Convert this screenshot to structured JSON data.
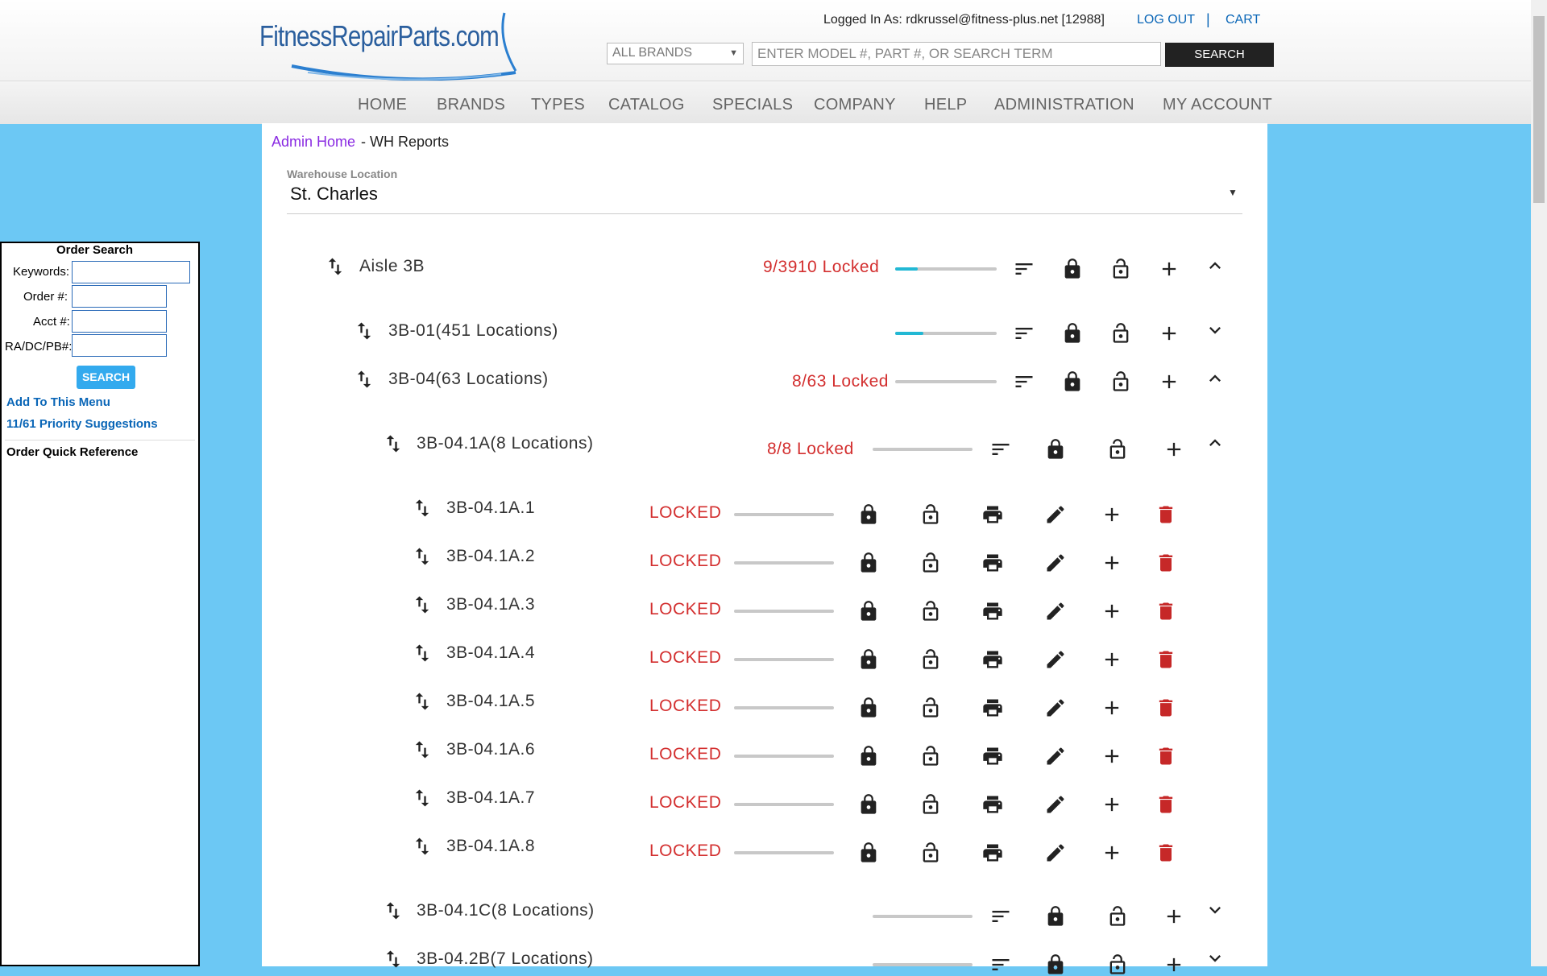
{
  "header": {
    "logo_text": "FitnessRepairParts.com",
    "logged_in": "Logged In As: rdkrussel@fitness-plus.net [12988]",
    "logout": "LOG OUT",
    "separator": "|",
    "cart": "CART",
    "brands_select": "ALL BRANDS",
    "search_placeholder": "ENTER MODEL #, PART #, OR SEARCH TERM",
    "search_button": "SEARCH"
  },
  "nav": [
    "HOME",
    "BRANDS",
    "TYPES",
    "CATALOG",
    "SPECIALS",
    "COMPANY",
    "HELP",
    "ADMINISTRATION",
    "MY ACCOUNT"
  ],
  "sidebar": {
    "title": "Order Search",
    "fields": [
      "Keywords:",
      "Order #:",
      "Acct #:",
      "RA/DC/PB#:"
    ],
    "search_button": "SEARCH",
    "links": [
      "Add To This Menu",
      "11/61 Priority Suggestions"
    ],
    "quick_reference": "Order Quick Reference"
  },
  "breadcrumb": {
    "admin_home": "Admin Home",
    "rest": " - WH Reports"
  },
  "warehouse": {
    "label": "Warehouse Location",
    "value": "St. Charles"
  },
  "tree": {
    "aisle": {
      "label": "Aisle 3B",
      "status": "9/3910 Locked",
      "progress": 0.22,
      "expanded": true
    },
    "groups": [
      {
        "label": "3B-01(451 Locations)",
        "status": "",
        "progress": 0.28,
        "expanded": false
      },
      {
        "label": "3B-04(63 Locations)",
        "status": "8/63 Locked",
        "progress": 0,
        "expanded": true
      }
    ],
    "subgroups": [
      {
        "label": "3B-04.1A(8 Locations)",
        "status": "8/8 Locked",
        "progress": 0,
        "expanded": true
      },
      {
        "label": "3B-04.1C(8 Locations)",
        "status": "",
        "progress": 0,
        "expanded": false
      },
      {
        "label": "3B-04.2B(7 Locations)",
        "status": "",
        "progress": 0,
        "expanded": false
      }
    ],
    "locations": [
      {
        "label": "3B-04.1A.1",
        "status": "LOCKED"
      },
      {
        "label": "3B-04.1A.2",
        "status": "LOCKED"
      },
      {
        "label": "3B-04.1A.3",
        "status": "LOCKED"
      },
      {
        "label": "3B-04.1A.4",
        "status": "LOCKED"
      },
      {
        "label": "3B-04.1A.5",
        "status": "LOCKED"
      },
      {
        "label": "3B-04.1A.6",
        "status": "LOCKED"
      },
      {
        "label": "3B-04.1A.7",
        "status": "LOCKED"
      },
      {
        "label": "3B-04.1A.8",
        "status": "LOCKED"
      }
    ]
  },
  "colors": {
    "background": "#6cc8f4",
    "locked_red": "#d32f2f",
    "link_blue": "#0a66b7",
    "progress_teal": "#22b8d4",
    "delete_red": "#c62828"
  }
}
